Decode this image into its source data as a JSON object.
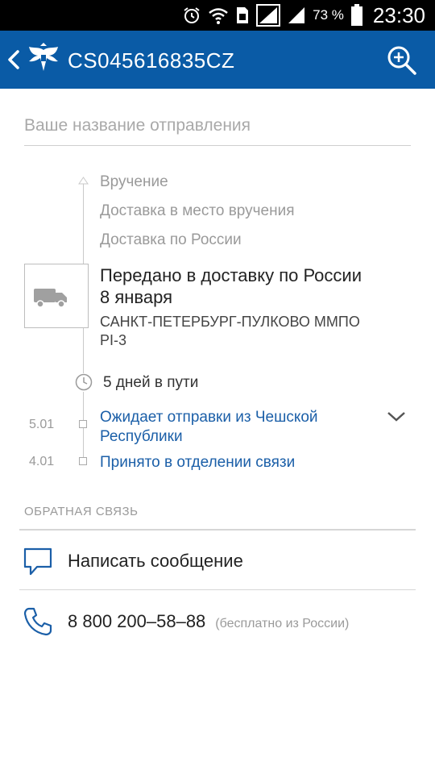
{
  "status_bar": {
    "battery_percent": "73 %",
    "time": "23:30"
  },
  "header": {
    "title": "CS045616835CZ",
    "bg_color": "#0a5ba6"
  },
  "name_field": {
    "placeholder": "Ваше название отправления"
  },
  "timeline": {
    "future_stages": [
      "Вручение",
      "Доставка в место вручения",
      "Доставка по России"
    ],
    "current": {
      "title_line1": "Передано в доставку по России",
      "title_line2": "8 января",
      "place_line1": "САНКТ-ПЕТЕРБУРГ-ПУЛКОВО ММПО",
      "place_line2": "PI-3"
    },
    "days_in_transit": "5 дней в пути",
    "events": [
      {
        "date": "5.01",
        "line1": "Ожидает отправки из Чешской",
        "line2": "Республики"
      },
      {
        "date": "4.01",
        "line1": "Принято в отделении связи",
        "line2": ""
      }
    ]
  },
  "feedback": {
    "section_title": "ОБРАТНАЯ СВЯЗЬ",
    "write_label": "Написать сообщение",
    "phone_number": "8 800 200–58–88",
    "phone_note": "(бесплатно из России)",
    "accent_color": "#1b5fa8"
  }
}
